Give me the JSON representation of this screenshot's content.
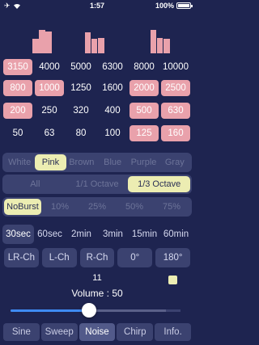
{
  "status": {
    "time": "1:57",
    "battery": "100%"
  },
  "spectrum_levels": [
    0.55,
    0.9,
    0.85,
    0.0,
    0.0,
    0.0,
    0.0,
    0.0,
    0.8,
    0.55,
    0.6,
    0.0,
    0.0,
    0.0,
    0.0,
    0.0,
    0.0,
    0.0,
    0.9,
    0.6,
    0.55
  ],
  "frequencies": {
    "rows": [
      [
        {
          "label": "3150",
          "on": true
        },
        {
          "label": "4000",
          "on": false
        },
        {
          "label": "5000",
          "on": false
        },
        {
          "label": "6300",
          "on": false
        },
        {
          "label": "8000",
          "on": false
        },
        {
          "label": "10000",
          "on": false
        }
      ],
      [
        {
          "label": "800",
          "on": true
        },
        {
          "label": "1000",
          "on": true
        },
        {
          "label": "1250",
          "on": false
        },
        {
          "label": "1600",
          "on": false
        },
        {
          "label": "2000",
          "on": true
        },
        {
          "label": "2500",
          "on": true
        }
      ],
      [
        {
          "label": "200",
          "on": true
        },
        {
          "label": "250",
          "on": false
        },
        {
          "label": "320",
          "on": false
        },
        {
          "label": "400",
          "on": false
        },
        {
          "label": "500",
          "on": true
        },
        {
          "label": "630",
          "on": true
        }
      ],
      [
        {
          "label": "50",
          "on": false
        },
        {
          "label": "63",
          "on": false
        },
        {
          "label": "80",
          "on": false
        },
        {
          "label": "100",
          "on": false
        },
        {
          "label": "125",
          "on": true
        },
        {
          "label": "160",
          "on": true
        }
      ]
    ]
  },
  "noise_color": {
    "options": [
      "White",
      "Pink",
      "Brown",
      "Blue",
      "Purple",
      "Gray"
    ],
    "selected": 1
  },
  "octave": {
    "options": [
      "All",
      "1/1 Octave",
      "1/3 Octave"
    ],
    "selected": 2
  },
  "burst": {
    "options": [
      "NoBurst",
      "10%",
      "25%",
      "50%",
      "75%"
    ],
    "selected": 0
  },
  "duration": {
    "options": [
      "30sec",
      "60sec",
      "2min",
      "3min",
      "15min",
      "60min"
    ],
    "selected": 0
  },
  "channel": {
    "options": [
      "LR-Ch",
      "L-Ch",
      "R-Ch",
      "0°",
      "180°"
    ]
  },
  "counter": "11",
  "volume_label": "Volume : 50",
  "volume_level": 0.5,
  "modes": {
    "options": [
      "Sine",
      "Sweep",
      "Noise",
      "Chirp",
      "Info."
    ],
    "selected": 2
  }
}
